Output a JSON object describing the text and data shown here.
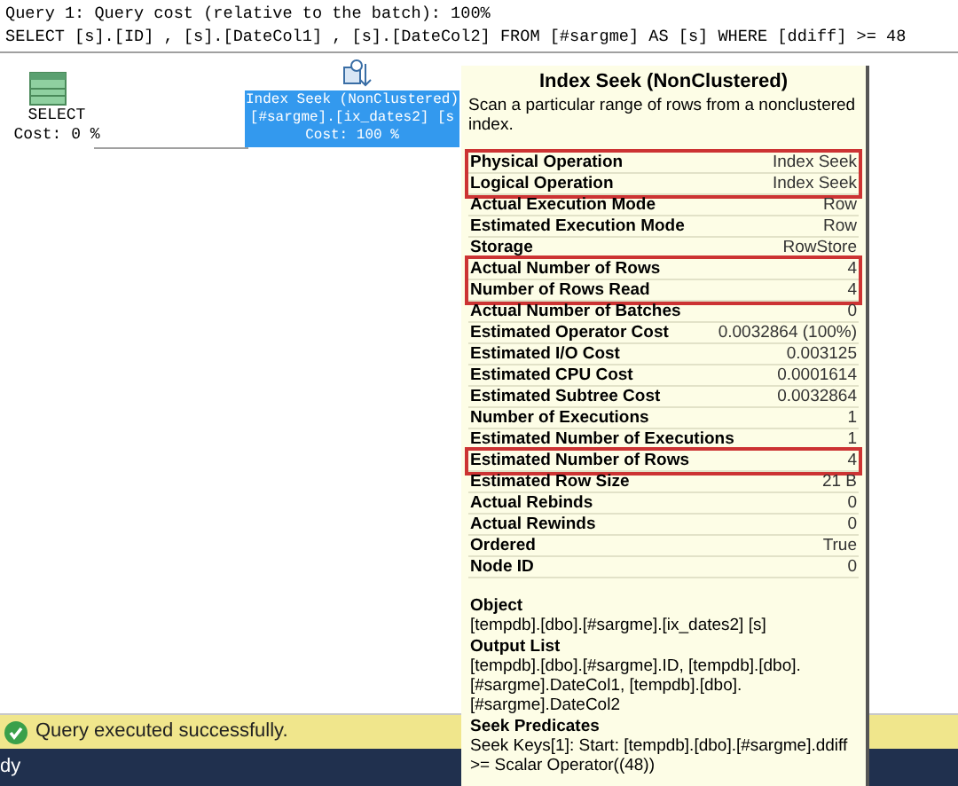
{
  "header": {
    "lines": [
      "Query 1: Query cost (relative to the batch): 100%",
      "SELECT [s].[ID] , [s].[DateCol1] , [s].[DateCol2] FROM [#sargme] AS [s] WHERE [ddiff] >= 48"
    ]
  },
  "plan": {
    "select_node": {
      "label": "SELECT",
      "cost": "Cost: 0 %"
    },
    "seek_node": {
      "selected": true,
      "lines": [
        "Index Seek (NonClustered)",
        "[#sargme].[ix_dates2] [s",
        "Cost: 100 %"
      ]
    }
  },
  "tooltip": {
    "title": "Index Seek (NonClustered)",
    "description": "Scan a particular range of rows from a nonclustered index.",
    "groups": [
      {
        "boxed": true,
        "rows": [
          {
            "name": "Physical Operation",
            "value": "Index Seek"
          },
          {
            "name": "Logical Operation",
            "value": "Index Seek"
          }
        ]
      },
      {
        "boxed": false,
        "rows": [
          {
            "name": "Actual Execution Mode",
            "value": "Row"
          },
          {
            "name": "Estimated Execution Mode",
            "value": "Row"
          },
          {
            "name": "Storage",
            "value": "RowStore"
          }
        ]
      },
      {
        "boxed": true,
        "rows": [
          {
            "name": "Actual Number of Rows",
            "value": "4"
          },
          {
            "name": "Number of Rows Read",
            "value": "4"
          }
        ]
      },
      {
        "boxed": false,
        "rows": [
          {
            "name": "Actual Number of Batches",
            "value": "0"
          },
          {
            "name": "Estimated Operator Cost",
            "value": "0.0032864 (100%)"
          },
          {
            "name": "Estimated I/O Cost",
            "value": "0.003125"
          },
          {
            "name": "Estimated CPU Cost",
            "value": "0.0001614"
          },
          {
            "name": "Estimated Subtree Cost",
            "value": "0.0032864"
          },
          {
            "name": "Number of Executions",
            "value": "1"
          },
          {
            "name": "Estimated Number of Executions",
            "value": "1"
          }
        ]
      },
      {
        "boxed": true,
        "rows": [
          {
            "name": "Estimated Number of Rows",
            "value": "4"
          }
        ]
      },
      {
        "boxed": false,
        "rows": [
          {
            "name": "Estimated Row Size",
            "value": "21 B"
          },
          {
            "name": "Actual Rebinds",
            "value": "0"
          },
          {
            "name": "Actual Rewinds",
            "value": "0"
          },
          {
            "name": "Ordered",
            "value": "True"
          },
          {
            "name": "Node ID",
            "value": "0"
          }
        ]
      }
    ],
    "sections": [
      {
        "heading": "Object",
        "text": "[tempdb].[dbo].[#sargme].[ix_dates2] [s]"
      },
      {
        "heading": "Output List",
        "text": "[tempdb].[dbo].[#sargme].ID, [tempdb].[dbo].[#sargme].DateCol1, [tempdb].[dbo].[#sargme].DateCol2"
      },
      {
        "heading": "Seek Predicates",
        "text": "Seek Keys[1]: Start: [tempdb].[dbo].[#sargme].ddiff >= Scalar Operator((48))"
      }
    ]
  },
  "status": {
    "message": "Query executed successfully.",
    "footer": "dy"
  }
}
